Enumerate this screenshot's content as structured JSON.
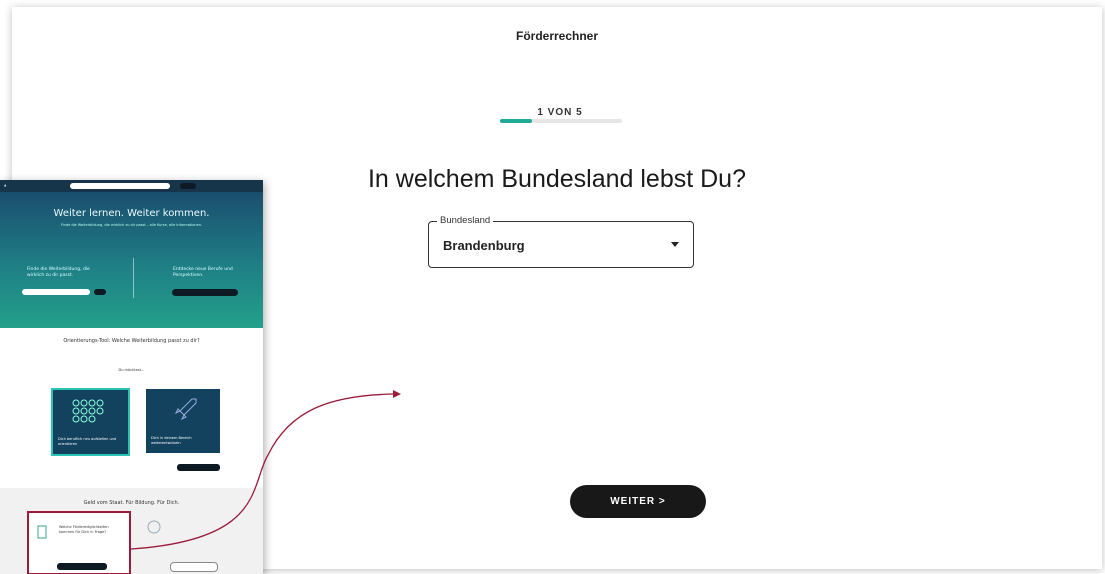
{
  "app": {
    "title": "Förderrechner"
  },
  "stepper": {
    "label": "1 VON 5",
    "progress": 0.26
  },
  "question": {
    "text": "In welchem Bundesland lebst Du?"
  },
  "state_select": {
    "legend": "Bundesland",
    "value": "Brandenburg"
  },
  "next_button": {
    "label": "WEITER >"
  },
  "overlay": {
    "hero_title": "Weiter lernen. Weiter kommen.",
    "hero_sub": "Finde die Weiterbildung, die wirklich zu dir passt – alle Kurse, alle Informationen.",
    "find_text": "Finde die Weiterbildung, die wirklich zu dir passt.",
    "discover_text": "Entdecke neue Berufe und Perspektiven.",
    "orientation_title": "Orientierungs-Tool: Welche Weiterbildung passt zu dir?",
    "prompt": "Du möchtest…",
    "card1_text": "Dich beruflich neu aufstellen und orientieren",
    "card2_text": "Dich in deinem Bereich weiterentwickeln",
    "money_title": "Geld vom Staat. Für Bildung. Für Dich.",
    "highlight_text": "Welche Fördermöglichkeiten kommen für Dich in Frage?"
  },
  "colors": {
    "accent": "#1faa96",
    "button_bg": "#181818",
    "hero_start": "#1a4e6e",
    "hero_end": "#23a08a",
    "highlight_border": "#9b1c3a",
    "arrow": "#9b1c3a"
  }
}
